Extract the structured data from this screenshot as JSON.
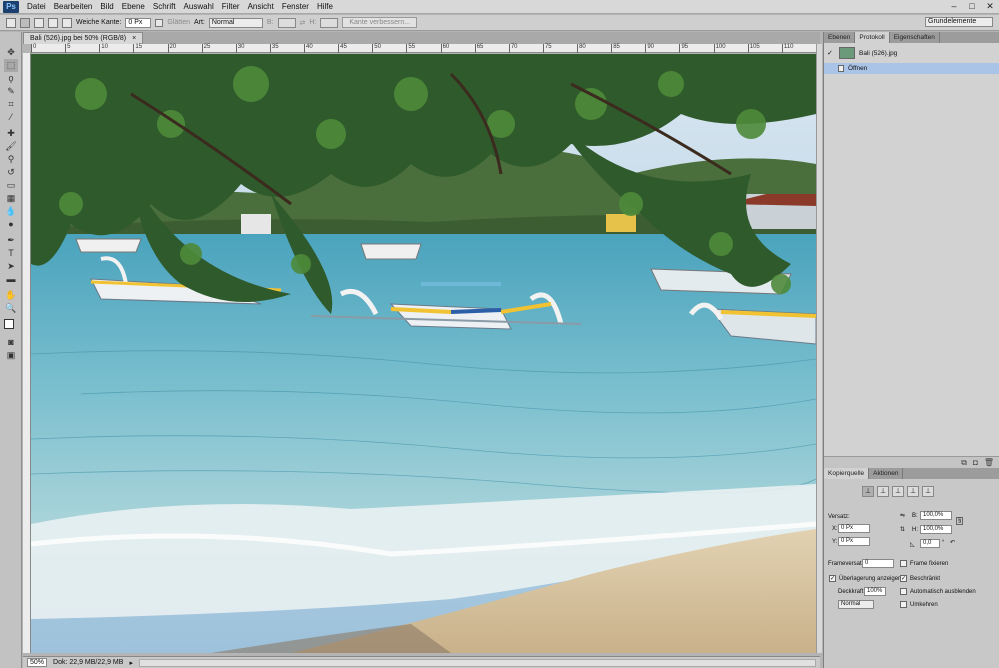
{
  "app": {
    "logo": "Ps"
  },
  "menu": [
    "Datei",
    "Bearbeiten",
    "Bild",
    "Ebene",
    "Schrift",
    "Auswahl",
    "Filter",
    "Ansicht",
    "Fenster",
    "Hilfe"
  ],
  "window_controls": {
    "minimize": "–",
    "maximize": "□",
    "close": "✕"
  },
  "options": {
    "feather_label": "Weiche Kante:",
    "feather_value": "0 Px",
    "antialias_label": "Glätten",
    "style_label": "Art:",
    "style_value": "Normal",
    "width_label": "B:",
    "height_label": "H:",
    "refine_edge": "Kante verbessern...",
    "workspace": "Grundelemente"
  },
  "document": {
    "tab_title": "Bali (526).jpg bei 50% (RGB/8)",
    "tab_close": "×",
    "ruler_ticks": [
      "0",
      "5",
      "10",
      "15",
      "20",
      "25",
      "30",
      "35",
      "40",
      "45",
      "50",
      "55",
      "60",
      "65",
      "70",
      "75",
      "80",
      "85",
      "90",
      "95",
      "100",
      "105",
      "110"
    ]
  },
  "status": {
    "zoom": "50%",
    "doc_info": "Dok: 22,9 MB/22,9 MB"
  },
  "history_panel": {
    "tabs": [
      "Ebenen",
      "Protokoll",
      "Eigenschaften"
    ],
    "snapshot_name": "Bali (526).jpg",
    "steps": [
      "Öffnen"
    ]
  },
  "clone_source_panel": {
    "tabs": [
      "Kopierquelle",
      "Aktionen"
    ],
    "offset_label": "Versatz:",
    "x_label": "X:",
    "x_value": "0 Px",
    "y_label": "Y:",
    "y_value": "0 Px",
    "w_label": "B:",
    "w_value": "100,0%",
    "h_label": "H:",
    "h_value": "100,0%",
    "angle_value": "0,0",
    "angle_unit": "°",
    "frame_offset_label": "Frameversatz:",
    "frame_offset_value": "0",
    "lock_frame_label": "Frame fixieren",
    "show_overlay_label": "Überlagerung anzeigen",
    "clipped_label": "Beschränkt",
    "opacity_label": "Deckkraft:",
    "opacity_value": "100%",
    "auto_hide_label": "Automatisch ausblenden",
    "blend_value": "Normal",
    "invert_label": "Umkehren"
  },
  "colors": {
    "sky": "#bcd6ea",
    "sea": "#6fb3c6",
    "sand": "#d8c4a2",
    "leaf": "#2f5a2c"
  }
}
